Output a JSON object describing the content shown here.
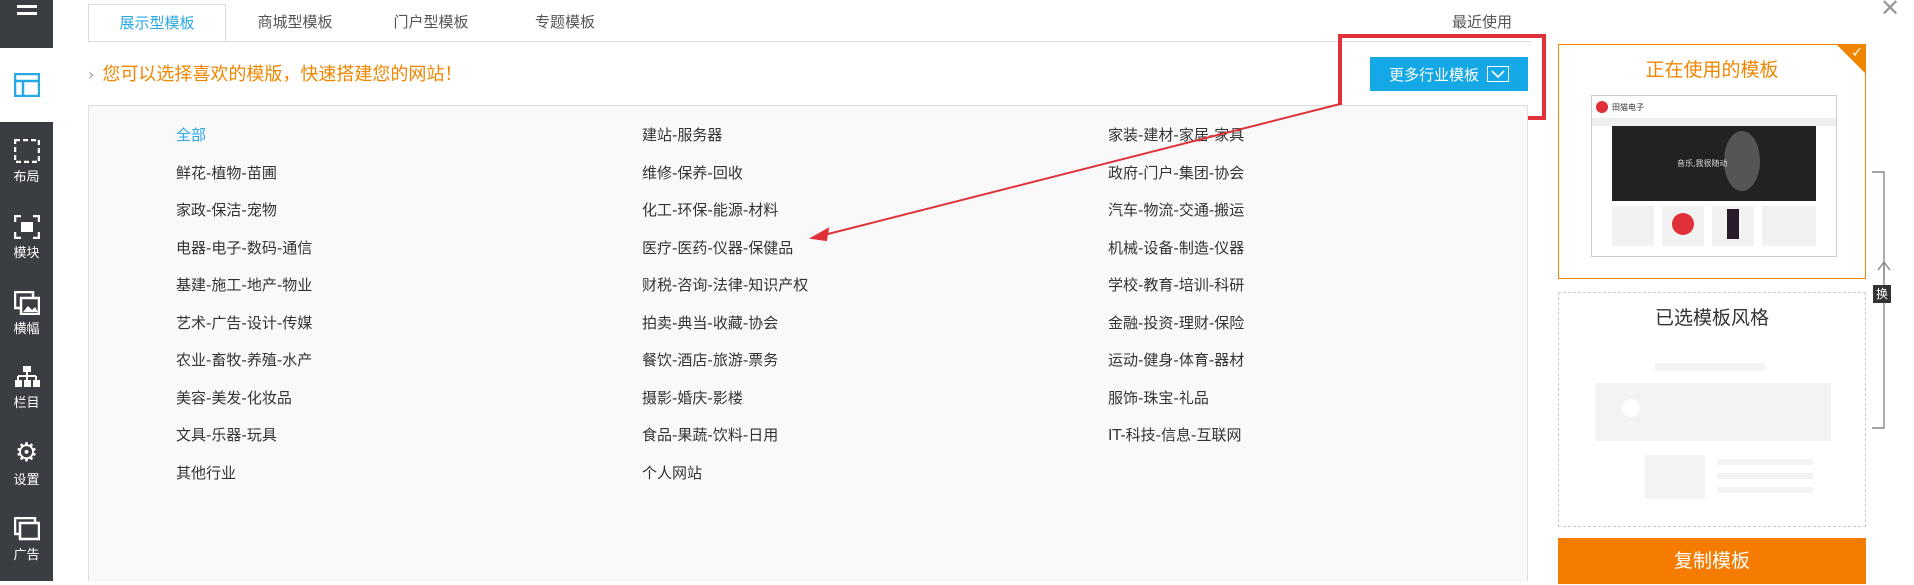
{
  "sidebar": {
    "items": [
      {
        "icon": "layout-icon",
        "label": "布局"
      },
      {
        "icon": "module-icon",
        "label": "模块"
      },
      {
        "icon": "banner-icon",
        "label": "横幅"
      },
      {
        "icon": "column-icon",
        "label": "栏目"
      },
      {
        "icon": "gear-icon",
        "label": "设置"
      },
      {
        "icon": "ad-icon",
        "label": "广告"
      }
    ]
  },
  "tabs": [
    "展示型模板",
    "商城型模板",
    "门户型模板",
    "专题模板"
  ],
  "recent_label": "最近使用",
  "hint_text": "您可以选择喜欢的模版，快速搭建您的网站！",
  "more_button_label": "更多行业模板",
  "categories": [
    [
      "全部",
      "建站-服务器",
      "家装-建材-家居-家具"
    ],
    [
      "鲜花-植物-苗圃",
      "维修-保养-回收",
      "政府-门户-集团-协会"
    ],
    [
      "家政-保洁-宠物",
      "化工-环保-能源-材料",
      "汽车-物流-交通-搬运"
    ],
    [
      "电器-电子-数码-通信",
      "医疗-医药-仪器-保健品",
      "机械-设备-制造-仪器"
    ],
    [
      "基建-施工-地产-物业",
      "财税-咨询-法律-知识产权",
      "学校-教育-培训-科研"
    ],
    [
      "艺术-广告-设计-传媒",
      "拍卖-典当-收藏-协会",
      "金融-投资-理财-保险"
    ],
    [
      "农业-畜牧-养殖-水产",
      "餐饮-酒店-旅游-票务",
      "运动-健身-体育-器材"
    ],
    [
      "美容-美发-化妆品",
      "摄影-婚庆-影楼",
      "服饰-珠宝-礼品"
    ],
    [
      "文具-乐器-玩具",
      "食品-果蔬-饮料-日用",
      "IT-科技-信息-互联网"
    ],
    [
      "其他行业",
      "个人网站",
      ""
    ]
  ],
  "selected_category": "全部",
  "current_template": {
    "title": "正在使用的模板",
    "thumb_logo": "田猫电子",
    "thumb_banner": "音乐,我很随动"
  },
  "selected_style_title": "已选模板风格",
  "swap_label": "换",
  "copy_button_label": "复制模板",
  "colors": {
    "accent_blue": "#15a8e6",
    "accent_orange": "#f08600",
    "sidebar_bg": "#3a3d42",
    "highlight_red": "#e0313a"
  }
}
